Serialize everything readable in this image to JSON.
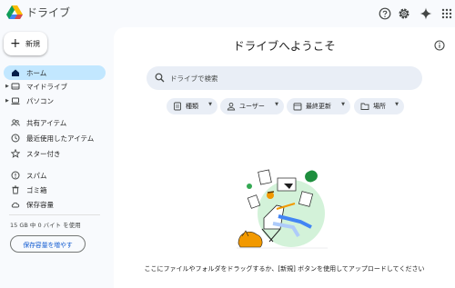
{
  "app": {
    "title": "ドライブ"
  },
  "topbar": {
    "icons": [
      "help-icon",
      "settings-icon",
      "gemini-sparkle-icon",
      "apps-grid-icon"
    ]
  },
  "sidebar": {
    "new_label": "新規",
    "items": [
      {
        "label": "ホーム",
        "icon": "home-icon",
        "active": true
      },
      {
        "label": "マイドライブ",
        "icon": "my-drive-icon"
      },
      {
        "label": "パソコン",
        "icon": "computer-icon"
      },
      {
        "label": "共有アイテム",
        "icon": "shared-icon"
      },
      {
        "label": "最近使用したアイテム",
        "icon": "recent-icon"
      },
      {
        "label": "スター付き",
        "icon": "star-icon"
      },
      {
        "label": "スパム",
        "icon": "spam-icon"
      },
      {
        "label": "ゴミ箱",
        "icon": "trash-icon"
      },
      {
        "label": "保存容量",
        "icon": "cloud-icon"
      }
    ],
    "storage_text": "15 GB 中 0 バイト を使用",
    "storage_button": "保存容量を増やす"
  },
  "main": {
    "welcome": "ドライブへようこそ",
    "search_placeholder": "ドライブで検索",
    "filters": [
      {
        "label": "種類",
        "icon": "file-type-icon"
      },
      {
        "label": "ユーザー",
        "icon": "person-icon"
      },
      {
        "label": "最終更新",
        "icon": "calendar-icon"
      },
      {
        "label": "場所",
        "icon": "folder-icon"
      }
    ],
    "hint": "ここにファイルやフォルダをドラッグするか、[新規] ボタンを使用してアップロードしてください"
  },
  "colors": {
    "background": "#f8fafd",
    "active_nav": "#c2e7ff",
    "chip": "#e9eef6",
    "link": "#0b57d0"
  }
}
